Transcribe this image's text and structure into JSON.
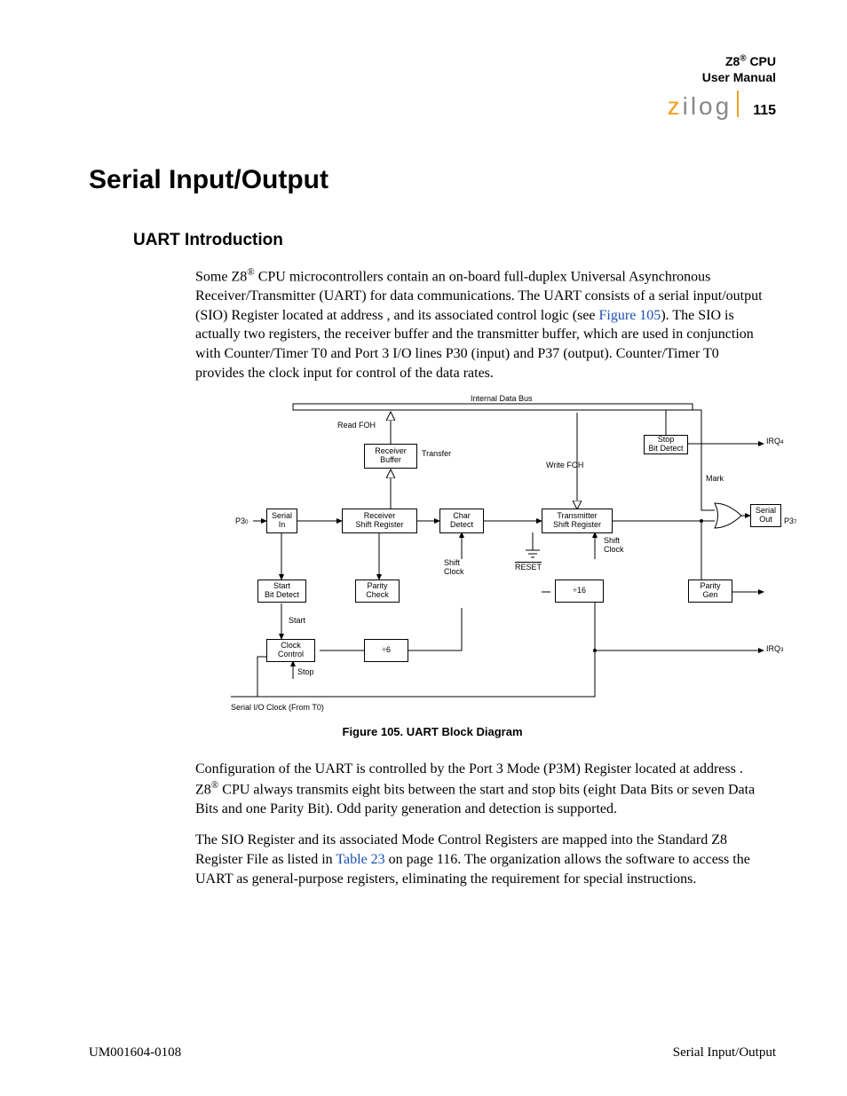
{
  "header": {
    "product": "Z8",
    "reg": "®",
    "cpu": "CPU",
    "manual": "User Manual",
    "logo_z": "z",
    "logo_rest": "ilog",
    "page": "115"
  },
  "h1": "Serial Input/Output",
  "h2": "UART Introduction",
  "para1_a": "Some Z8",
  "para1_reg": "®",
  "para1_b": " CPU microcontrollers contain an on-board full-duplex Universal Asynchronous Receiver/Transmitter (UART) for data communications. The UART consists of a serial input/output (SIO) Register located at address        , and its associated control logic (see ",
  "para1_link": "Figure 105",
  "para1_c": "). The SIO is actually two registers, the receiver buffer and the transmitter buffer, which are used in conjunction with Counter/Timer T0 and Port 3 I/O lines P30 (input) and P37 (output). Counter/Timer T0 provides the clock input for control of the data rates.",
  "figcaption": "Figure 105. UART Block Diagram",
  "para2_a": "Configuration of the UART is controlled by the Port 3 Mode (P3M) Register located at address        . Z8",
  "para2_reg": "®",
  "para2_b": " CPU always transmits eight bits between the start and stop bits (eight Data Bits or seven Data Bits and one Parity Bit). Odd parity generation and detection is supported.",
  "para3_a": "The SIO Register and its associated Mode Control Registers are mapped into the Standard Z8 Register File as listed in ",
  "para3_link": "Table 23",
  "para3_b": " on page 116. The organization allows the software to access the UART as general-purpose registers, eliminating the requirement for special instructions.",
  "footer": {
    "left": "UM001604-0108",
    "right": "Serial Input/Output"
  },
  "diagram": {
    "internal_bus": "Internal Data Bus",
    "read_foh": "Read FOH",
    "receiver_buffer": "Receiver\nBuffer",
    "transfer": "Transfer",
    "write_foh": "Write FOH",
    "stop_bit_detect": "Stop\nBit Detect",
    "mark": "Mark",
    "p30": "P3",
    "p30_sub": "0",
    "serial_in": "Serial\nIn",
    "receiver_shift": "Receiver\nShift Register",
    "char_detect": "Char\nDetect",
    "transmitter_shift": "Transmitter\nShift Register",
    "serial_out": "Serial\nOut",
    "p37": "P3",
    "p37_sub": "7",
    "shift_clock1": "Shift\nClock",
    "shift_clock2": "Shift\nClock",
    "reset": "RESET",
    "start_bit_detect": "Start\nBit Detect",
    "parity_check": "Parity\nCheck",
    "div16": "÷16",
    "parity_gen": "Parity\nGen",
    "start": "Start",
    "clock_control": "Clock\nControl",
    "div6": "÷6",
    "stop": "Stop",
    "sio_clock": "Serial I/O Clock (From T0)",
    "irq4": "IRQ",
    "irq4_sub": "4",
    "irq3": "IRQ",
    "irq3_sub": "3"
  }
}
